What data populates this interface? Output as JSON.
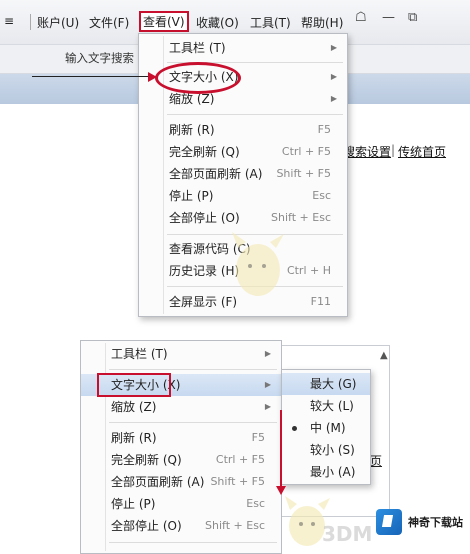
{
  "top": {
    "menubar": {
      "items": [
        "账户(U)",
        "文件(F)",
        "查看(V)",
        "收藏(O)",
        "工具(T)",
        "帮助(H)"
      ],
      "active_index": 2
    },
    "search_placeholder": "输入文字搜索",
    "links": [
      "搜索设置",
      "传统首页"
    ],
    "view_menu": {
      "items": [
        {
          "label": "工具栏 (T)",
          "shortcut": "",
          "submenu": true
        },
        {
          "label": "文字大小 (X)",
          "shortcut": "",
          "submenu": true,
          "circled": true
        },
        {
          "label": "缩放 (Z)",
          "shortcut": "",
          "submenu": true
        },
        {
          "label": "刷新 (R)",
          "shortcut": "F5",
          "submenu": false
        },
        {
          "label": "完全刷新 (Q)",
          "shortcut": "Ctrl + F5",
          "submenu": false
        },
        {
          "label": "全部页面刷新 (A)",
          "shortcut": "Shift + F5",
          "submenu": false
        },
        {
          "label": "停止 (P)",
          "shortcut": "Esc",
          "submenu": false
        },
        {
          "label": "全部停止 (O)",
          "shortcut": "Shift + Esc",
          "submenu": false
        },
        {
          "label": "查看源代码 (C)",
          "shortcut": "",
          "submenu": false
        },
        {
          "label": "历史记录 (H)",
          "shortcut": "Ctrl + H",
          "submenu": false
        },
        {
          "label": "全屏显示 (F)",
          "shortcut": "F11",
          "submenu": false
        }
      ]
    }
  },
  "bottom": {
    "view_menu": {
      "items": [
        {
          "label": "工具栏 (T)",
          "shortcut": "",
          "submenu": true
        },
        {
          "label": "文字大小 (X)",
          "shortcut": "",
          "submenu": true,
          "highlighted": true
        },
        {
          "label": "缩放 (Z)",
          "shortcut": "",
          "submenu": true
        },
        {
          "label": "刷新 (R)",
          "shortcut": "F5",
          "submenu": false
        },
        {
          "label": "完全刷新 (Q)",
          "shortcut": "Ctrl + F5",
          "submenu": false
        },
        {
          "label": "全部页面刷新 (A)",
          "shortcut": "Shift + F5",
          "submenu": false
        },
        {
          "label": "停止 (P)",
          "shortcut": "Esc",
          "submenu": false
        },
        {
          "label": "全部停止 (O)",
          "shortcut": "Shift + Esc",
          "submenu": false
        }
      ]
    },
    "text_size_submenu": {
      "items": [
        "最大 (G)",
        "较大 (L)",
        "中 (M)",
        "较小 (S)",
        "最小 (A)"
      ],
      "highlighted_index": 0,
      "selected_index": 2
    },
    "partial_link": "页"
  },
  "branding": {
    "site_logo_text": "神奇下载站",
    "watermark": "3DM"
  },
  "colors": {
    "annotation_red": "#c8102e",
    "highlight_blue": "#c7d9f0",
    "logo_blue": "#1f78cf"
  }
}
